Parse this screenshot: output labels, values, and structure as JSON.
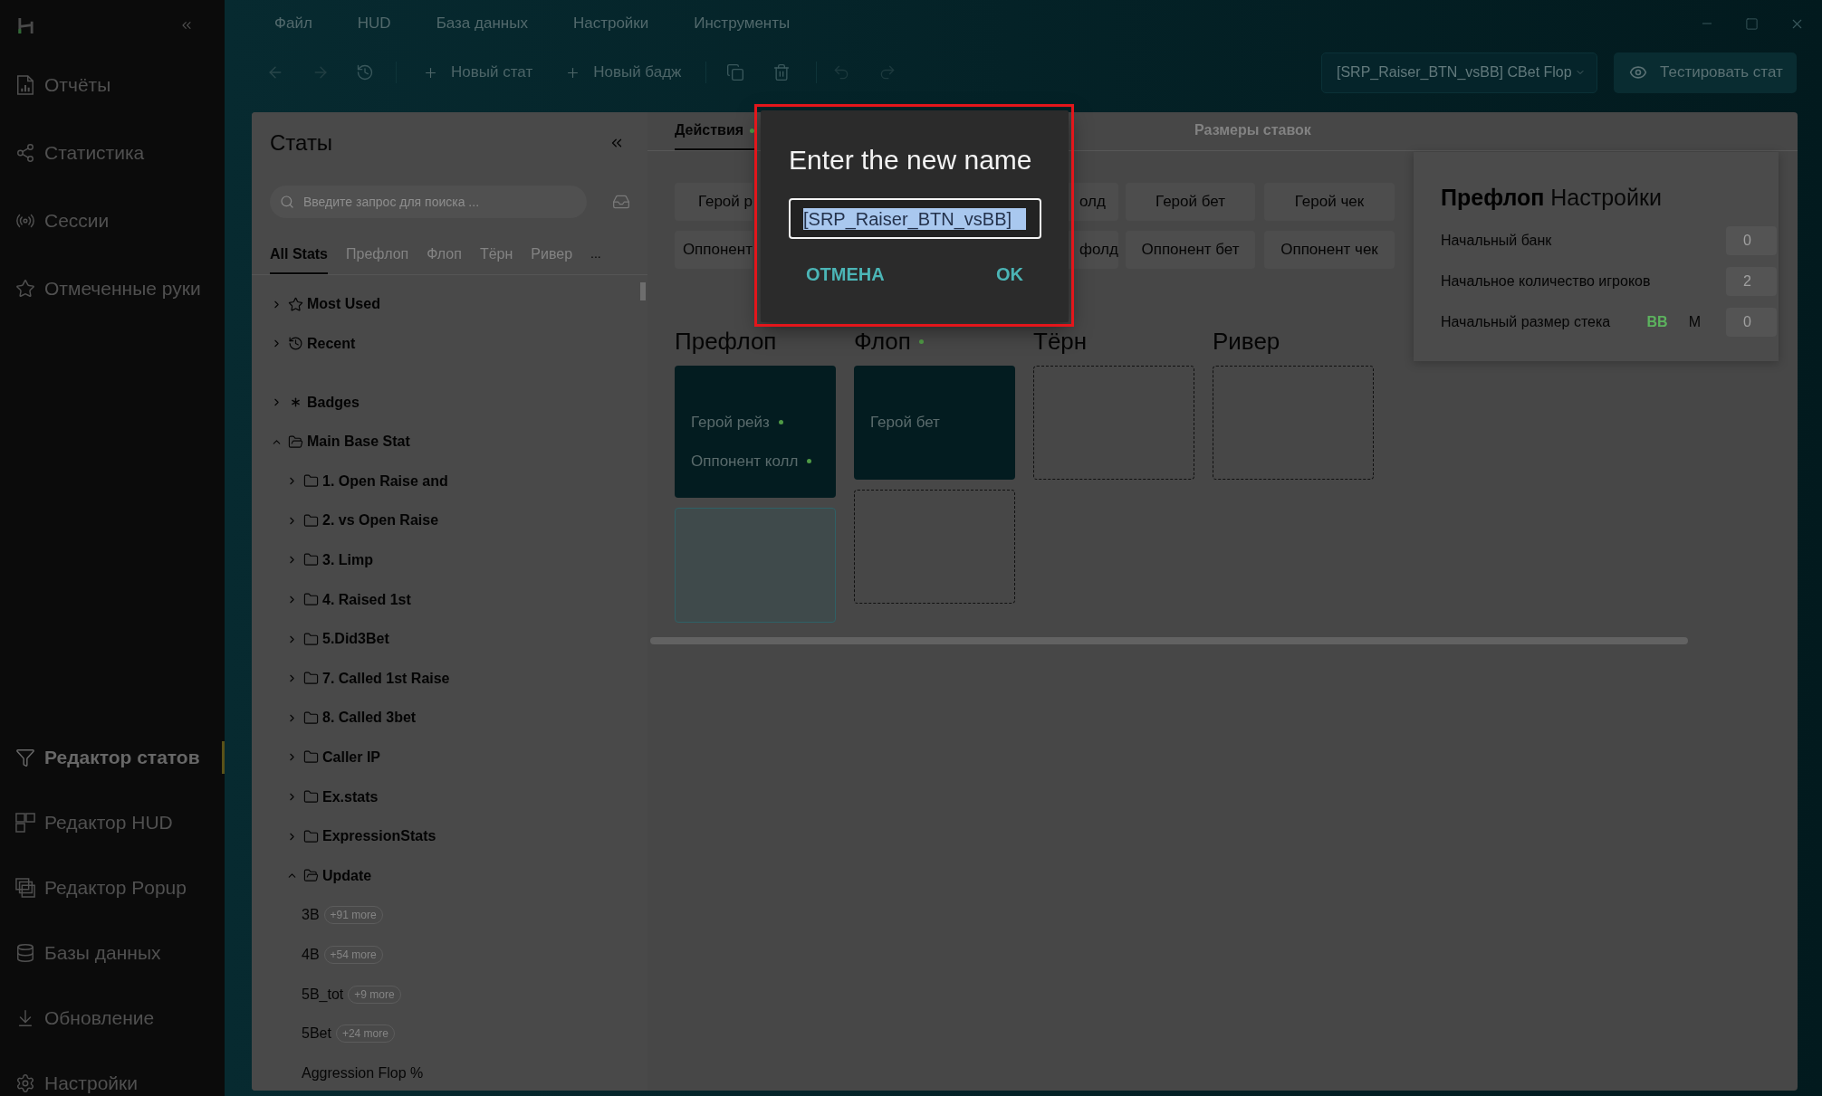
{
  "sidebar": {
    "main_items": [
      {
        "label": "Отчёты",
        "selected": false
      },
      {
        "label": "Статистика",
        "selected": false
      },
      {
        "label": "Сессии",
        "selected": false
      },
      {
        "label": "Отмеченные руки",
        "selected": false
      }
    ],
    "tool_items": [
      {
        "label": "Редактор статов",
        "selected": true
      },
      {
        "label": "Редактор HUD",
        "selected": false
      },
      {
        "label": "Редактор Popup",
        "selected": false
      },
      {
        "label": "Базы данных",
        "selected": false
      },
      {
        "label": "Обновление",
        "selected": false
      },
      {
        "label": "Настройки",
        "selected": false
      }
    ]
  },
  "menu": [
    "Файл",
    "HUD",
    "База данных",
    "Настройки",
    "Инструменты"
  ],
  "toolbar": {
    "buttons": [
      "Новый стат",
      "Новый бадж"
    ],
    "stat_selector": {
      "value": "[SRP_Raiser_BTN_vsBB] CBet Flop"
    },
    "test_button": "Тестировать стат"
  },
  "stats_panel": {
    "title": "Статы",
    "search": {
      "placeholder": "Введите запрос для поиска ..."
    },
    "tabs": [
      {
        "label": "All Stats",
        "selected": true
      },
      {
        "label": "Префлоп",
        "selected": false
      },
      {
        "label": "Флоп",
        "selected": false
      },
      {
        "label": "Тёрн",
        "selected": false
      },
      {
        "label": "Ривер",
        "selected": false
      }
    ],
    "more_tabs": "...",
    "pinned": [
      {
        "label": "Most Used",
        "kind": "most_used",
        "expanded": false
      },
      {
        "label": "Recent",
        "kind": "recent",
        "expanded": false
      }
    ],
    "tree": [
      {
        "label": "Badges",
        "kind": "badges",
        "expanded": false
      },
      {
        "label": "Main Base Stat",
        "kind": "folder",
        "expanded": true,
        "children": [
          {
            "label": "1. Open Raise and",
            "kind": "folder",
            "expanded": false
          },
          {
            "label": "2. vs Open Raise",
            "kind": "folder",
            "expanded": false
          },
          {
            "label": "3. Limp",
            "kind": "folder",
            "expanded": false
          },
          {
            "label": "4. Raised 1st",
            "kind": "folder",
            "expanded": false
          },
          {
            "label": "5.Did3Bet",
            "kind": "folder",
            "expanded": false
          },
          {
            "label": "7. Called 1st Raise",
            "kind": "folder",
            "expanded": false
          },
          {
            "label": "8. Called 3bet",
            "kind": "folder",
            "expanded": false
          },
          {
            "label": "Caller IP",
            "kind": "folder",
            "expanded": false
          },
          {
            "label": "Ex.stats",
            "kind": "folder",
            "expanded": false
          },
          {
            "label": "ExpressionStats",
            "kind": "folder",
            "expanded": false
          },
          {
            "label": "Update",
            "kind": "folder",
            "expanded": true,
            "children": [
              {
                "label": "3B",
                "kind": "stat",
                "more": "+91 more"
              },
              {
                "label": "4B",
                "kind": "stat",
                "more": "+54 more"
              },
              {
                "label": "5B_tot",
                "kind": "stat",
                "more": "+9 more"
              },
              {
                "label": "5Bet",
                "kind": "stat",
                "more": "+24 more"
              },
              {
                "label": "Aggression Flop %",
                "kind": "stat"
              }
            ]
          }
        ]
      }
    ]
  },
  "editor": {
    "tabs": [
      {
        "label": "Действия",
        "selected": true,
        "dot": true
      },
      {
        "label": "Размеры ставок",
        "selected": false,
        "dot": false
      }
    ],
    "actions": [
      [
        "Герой р",
        "олд",
        "Герой бет",
        "Герой чек"
      ],
      [
        "Оппонент",
        "фолд",
        "Оппонент бет",
        "Оппонент чек"
      ]
    ],
    "streets": [
      {
        "title": "Префлоп",
        "dot": false,
        "cards": [
          {
            "kind": "filled",
            "lines": [
              {
                "text": "Герой рейз",
                "dot": true
              },
              {
                "text": "Оппонент колл",
                "dot": true
              }
            ]
          },
          {
            "kind": "drop_target"
          }
        ]
      },
      {
        "title": "Флоп",
        "dot": true,
        "cards": [
          {
            "kind": "filled",
            "lines": [
              {
                "text": "Герой бет",
                "dot": false
              }
            ]
          },
          {
            "kind": "empty"
          }
        ]
      },
      {
        "title": "Тёрн",
        "dot": false,
        "cards": [
          {
            "kind": "empty"
          }
        ]
      },
      {
        "title": "Ривер",
        "dot": false,
        "cards": [
          {
            "kind": "empty"
          }
        ]
      }
    ],
    "settings": {
      "title": "**Префлоп** Настройки",
      "fields": [
        {
          "label": "Начальный банк",
          "value": "0"
        },
        {
          "label": "Начальное количество игроков",
          "value": "2"
        },
        {
          "label": "Начальный размер стека",
          "value": "0",
          "units": [
            {
              "label": "BB",
              "selected": true
            },
            {
              "label": "M",
              "selected": false
            }
          ]
        }
      ]
    }
  },
  "dialog": {
    "title": "Enter the new name",
    "input": {
      "value": "[SRP_Raiser_BTN_vsBB]",
      "selected": true
    },
    "buttons": [
      "ОТМЕНА",
      "OK"
    ]
  }
}
